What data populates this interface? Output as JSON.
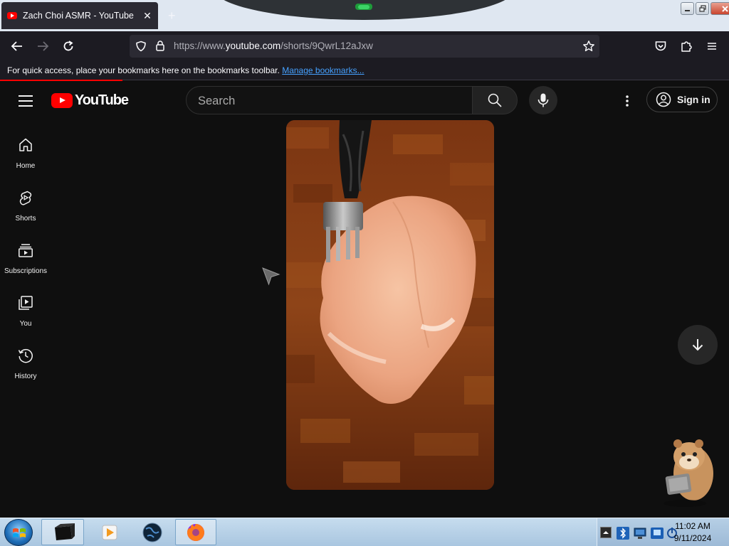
{
  "browser": {
    "tab_title": "Zach Choi ASMR - YouTube",
    "tab_close": "✕",
    "new_tab": "+",
    "url_prefix": "https://www.",
    "url_host": "youtube.com",
    "url_path": "/shorts/9QwrL12aJxw",
    "bookmarks_prompt": "For quick access, place your bookmarks here on the bookmarks toolbar.",
    "bookmarks_link": "Manage bookmarks..."
  },
  "youtube": {
    "logo_text": "YouTube",
    "search_placeholder": "Search",
    "sign_in": "Sign in",
    "sidebar": [
      {
        "label": "Home",
        "icon": "home-icon"
      },
      {
        "label": "Shorts",
        "icon": "shorts-icon"
      },
      {
        "label": "Subscriptions",
        "icon": "subscriptions-icon"
      },
      {
        "label": "You",
        "icon": "you-icon"
      },
      {
        "label": "History",
        "icon": "history-icon"
      }
    ],
    "short_content": "raw chicken breast pierced by a fork on a wooden cutting board",
    "brand_color": "#ff0000"
  },
  "taskbar": {
    "time": "11:02 AM",
    "date": "9/11/2024",
    "pinned": [
      "terminal-icon",
      "media-player-icon",
      "globe-icon",
      "firefox-icon"
    ]
  }
}
